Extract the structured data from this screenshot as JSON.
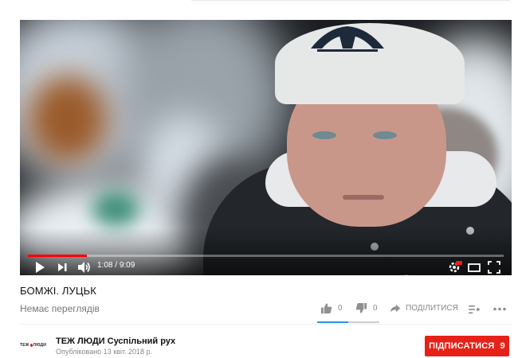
{
  "player": {
    "current_time": "1:08",
    "duration": "9:09",
    "progress_fraction": 0.124
  },
  "video": {
    "title": "БОМЖІ. ЛУЦЬК",
    "views_text": "Немає переглядів",
    "likes": "0",
    "dislikes": "0",
    "share_label": "ПОДІЛИТИСЯ"
  },
  "channel": {
    "name": "ТЕЖ ЛЮДИ Суспільний рух",
    "published": "Опубліковано 13 квіт. 2018 р.",
    "logo_text_left": "ТЕЖ",
    "logo_text_right": "ЛЮДИ",
    "subscribe_label": "ПІДПИСАТИСЯ",
    "subscriber_count": "9"
  },
  "colors": {
    "accent_red": "#e62117",
    "progress_red": "#ff0000",
    "like_blue": "#2793e6"
  }
}
